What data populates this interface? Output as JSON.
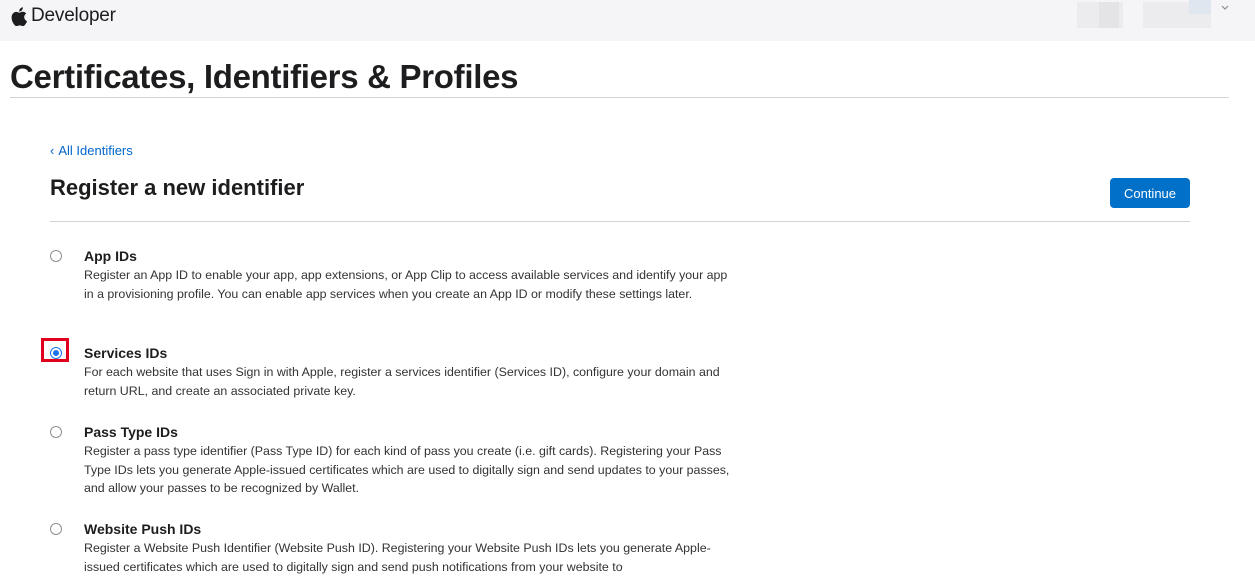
{
  "header": {
    "brand": "Developer",
    "logo_icon": "apple-icon",
    "account_icon": "chevron-down-icon"
  },
  "page": {
    "title": "Certificates, Identifiers & Profiles"
  },
  "main": {
    "back_link": "All Identifiers",
    "back_icon": "chevron-left-icon",
    "heading": "Register a new identifier",
    "continue_label": "Continue",
    "options": [
      {
        "title": "App IDs",
        "description": "Register an App ID to enable your app, app extensions, or App Clip to access available services and identify your app in a provisioning profile. You can enable app services when you create an App ID or modify these settings later.",
        "selected": false
      },
      {
        "title": "Services IDs",
        "description": "For each website that uses Sign in with Apple, register a services identifier (Services ID), configure your domain and return URL, and create an associated private key.",
        "selected": true
      },
      {
        "title": "Pass Type IDs",
        "description": "Register a pass type identifier (Pass Type ID) for each kind of pass you create (i.e. gift cards). Registering your Pass Type IDs lets you generate Apple-issued certificates which are used to digitally sign and send updates to your passes, and allow your passes to be recognized by Wallet.",
        "selected": false
      },
      {
        "title": "Website Push IDs",
        "description": "Register a Website Push Identifier (Website Push ID). Registering your Website Push IDs lets you generate Apple-issued certificates which are used to digitally sign and send push notifications from your website to",
        "selected": false
      }
    ]
  },
  "colors": {
    "accent": "#0070c9",
    "link": "#0066cc",
    "highlight": "#e0001b"
  }
}
